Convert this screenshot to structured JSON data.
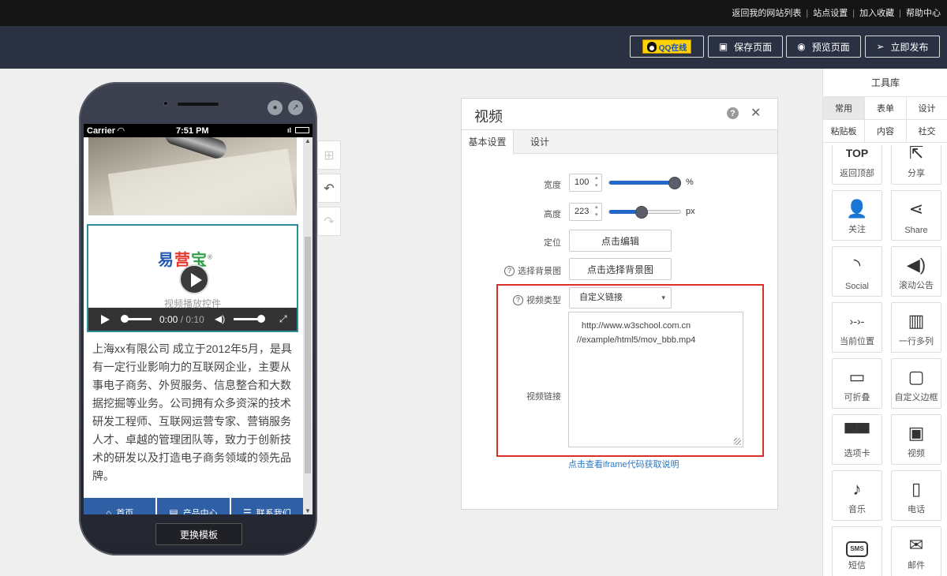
{
  "topbar": {
    "links": [
      "返回我的网站列表",
      "站点设置",
      "加入收藏",
      "帮助中心"
    ]
  },
  "header": {
    "qq_label": "QQ在线",
    "save_label": "保存页面",
    "preview_label": "预览页面",
    "publish_label": "立即发布"
  },
  "phone": {
    "status": {
      "carrier": "Carrier",
      "time": "7:51 PM"
    },
    "video": {
      "logo": {
        "part1": "易",
        "part2": "营",
        "part3": "宝",
        "reg": "®"
      },
      "label": "视频播放控件",
      "time_current": "0:00",
      "time_separator": "/",
      "time_total": "0:10"
    },
    "description": "上海xx有限公司 成立于2012年5月，是具有一定行业影响力的互联网企业，主要从事电子商务、外贸服务、信息整合和大数据挖掘等业务。公司拥有众多资深的技术研发工程师、互联网运营专家、营销服务人才、卓越的管理团队等，致力于创新技术的研发以及打造电子商务领域的领先品牌。",
    "nav": [
      "首页",
      "产品中心",
      "联系我们"
    ],
    "change_template_label": "更换模板"
  },
  "panel": {
    "title": "视频",
    "tabs": [
      "基本设置",
      "设计"
    ],
    "width": {
      "label": "宽度",
      "value": "100",
      "unit": "%",
      "slider_fraction": 0.92
    },
    "height": {
      "label": "高度",
      "value": "223",
      "unit": "px",
      "slider_fraction": 0.45
    },
    "position": {
      "label": "定位",
      "button": "点击编辑"
    },
    "background": {
      "label": "选择背景图",
      "button": "点击选择背景图"
    },
    "video_type": {
      "label": "视频类型",
      "value": "自定义链接"
    },
    "video_link": {
      "label": "视频链接",
      "line1": "http://www.w3school.com.cn",
      "line2": "//example/html5/mov_bbb.mp4"
    },
    "help_link": "点击查看iframe代码获取说明",
    "accent_color": "#2268c8",
    "highlight_color": "#d9302a"
  },
  "toolbox": {
    "title": "工具库",
    "tabs": [
      "常用",
      "表单",
      "设计",
      "粘贴板",
      "内容",
      "社交"
    ],
    "tools": [
      {
        "label": "返回顶部",
        "icon": "top-icon",
        "glyph": "TOP"
      },
      {
        "label": "分享",
        "icon": "share-out-icon",
        "glyph": "⇱"
      },
      {
        "label": "关注",
        "icon": "follow-icon",
        "glyph": "👤"
      },
      {
        "label": "Share",
        "icon": "share-icon",
        "glyph": "⋖"
      },
      {
        "label": "Social",
        "icon": "rss-icon",
        "glyph": "◝"
      },
      {
        "label": "滚动公告",
        "icon": "speaker-icon",
        "glyph": "◀)"
      },
      {
        "label": "当前位置",
        "icon": "breadcrumb-icon",
        "glyph": "›-›-"
      },
      {
        "label": "一行多列",
        "icon": "columns-icon",
        "glyph": "▥"
      },
      {
        "label": "可折叠",
        "icon": "collapse-icon",
        "glyph": "▭"
      },
      {
        "label": "自定义边框",
        "icon": "border-icon",
        "glyph": "▢"
      },
      {
        "label": "选项卡",
        "icon": "tabs-icon",
        "glyph": "▀▀"
      },
      {
        "label": "视频",
        "icon": "video-icon",
        "glyph": "▣"
      },
      {
        "label": "音乐",
        "icon": "music-icon",
        "glyph": "♪"
      },
      {
        "label": "电话",
        "icon": "phone-icon",
        "glyph": "▯"
      },
      {
        "label": "短信",
        "icon": "sms-icon",
        "glyph": "SMS"
      },
      {
        "label": "邮件",
        "icon": "mail-icon",
        "glyph": "✉"
      }
    ]
  }
}
